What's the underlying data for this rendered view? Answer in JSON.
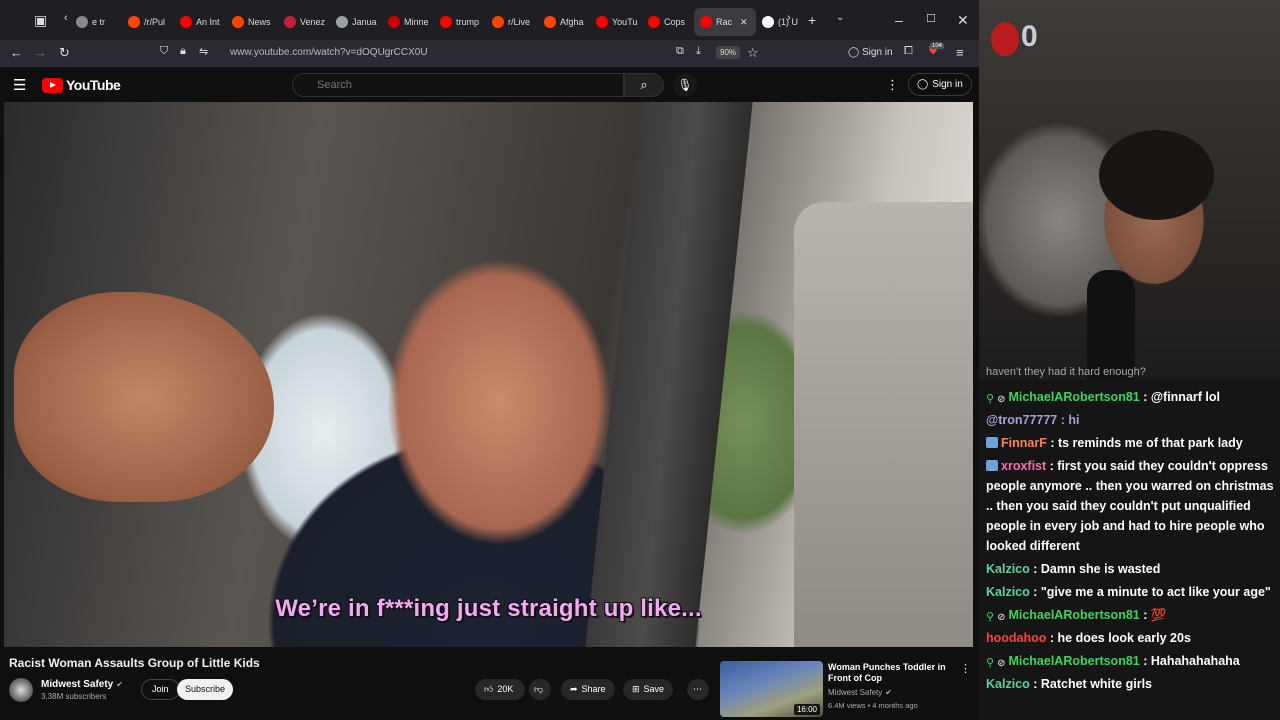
{
  "browser": {
    "tabs": [
      {
        "label": "e tr",
        "color": "#888888"
      },
      {
        "label": "/r/Pul",
        "color": "#ff4500"
      },
      {
        "label": "An Int",
        "color": "#ff0000"
      },
      {
        "label": "News",
        "color": "#ff4500"
      },
      {
        "label": "Venez",
        "color": "#c41e3a"
      },
      {
        "label": "Janua",
        "color": "#9aa0a6"
      },
      {
        "label": "Minne",
        "color": "#cc0000"
      },
      {
        "label": "trump",
        "color": "#ff0000"
      },
      {
        "label": "r/Live",
        "color": "#ff4500"
      },
      {
        "label": "Afgha",
        "color": "#ff4500"
      },
      {
        "label": "YouTu",
        "color": "#ff0000"
      },
      {
        "label": "Cops",
        "color": "#ff0000"
      },
      {
        "label": "Rac",
        "color": "#ff0000"
      },
      {
        "label": "(1) U",
        "color": "#ffffff"
      }
    ],
    "url": "www.youtube.com/watch?v=dOQUgrCCX0U",
    "zoom": "90%",
    "sign_in": "Sign in",
    "ext_badge": "104"
  },
  "youtube": {
    "logo_text": "YouTube",
    "search_placeholder": "Search",
    "sign_in": "Sign in",
    "subtitle": "We’re in f***ing just straight up like...",
    "video_title": "Racist Woman Assaults Group of Little Kids",
    "channel": "Midwest Safety",
    "subscribers": "3.38M subscribers",
    "join": "Join",
    "subscribe": "Subscribe",
    "likes": "20K",
    "share": "Share",
    "save": "Save",
    "recommended": {
      "title": "Woman Punches Toddler in Front of Cop",
      "channel": "Midwest Safety",
      "meta": "6.4M views • 4 months ago",
      "duration": "16:00"
    }
  },
  "stream": {
    "overlay_digit": "0",
    "chat_top": "haven't they had it hard enough?",
    "messages": [
      {
        "user": "MichaelARobertson81",
        "color": "#3ad65a",
        "badges": [
          "mod",
          "no"
        ],
        "text": "@finnarf lol"
      },
      {
        "user": "",
        "color": "#b19cd9",
        "badges": [],
        "text": "@tron77777 : hi"
      },
      {
        "user": "FinnarF",
        "color": "#ff7f50",
        "badges": [
          "sub"
        ],
        "text": "ts reminds me of that park lady"
      },
      {
        "user": "xroxfist",
        "color": "#ff69b4",
        "badges": [
          "sub"
        ],
        "text": "first you said they couldn't oppress people anymore .. then you warred on christmas .. then you said they couldn't put unqualified people in every job and had to hire people who looked different"
      },
      {
        "user": "Kalzico",
        "color": "#5fd39a",
        "badges": [],
        "text": "Damn she is wasted"
      },
      {
        "user": "Kalzico",
        "color": "#5fd39a",
        "badges": [],
        "text": "\"give me a minute to act like your age\""
      },
      {
        "user": "MichaelARobertson81",
        "color": "#3ad65a",
        "badges": [
          "mod",
          "no"
        ],
        "text": "💯"
      },
      {
        "user": "hoodahoo",
        "color": "#ff4040",
        "badges": [],
        "text": "he does look early 20s"
      },
      {
        "user": "MichaelARobertson81",
        "color": "#3ad65a",
        "badges": [
          "mod",
          "no"
        ],
        "text": "Hahahahahaha"
      },
      {
        "user": "Kalzico",
        "color": "#5fd39a",
        "badges": [],
        "text": "Ratchet white girls"
      }
    ]
  }
}
